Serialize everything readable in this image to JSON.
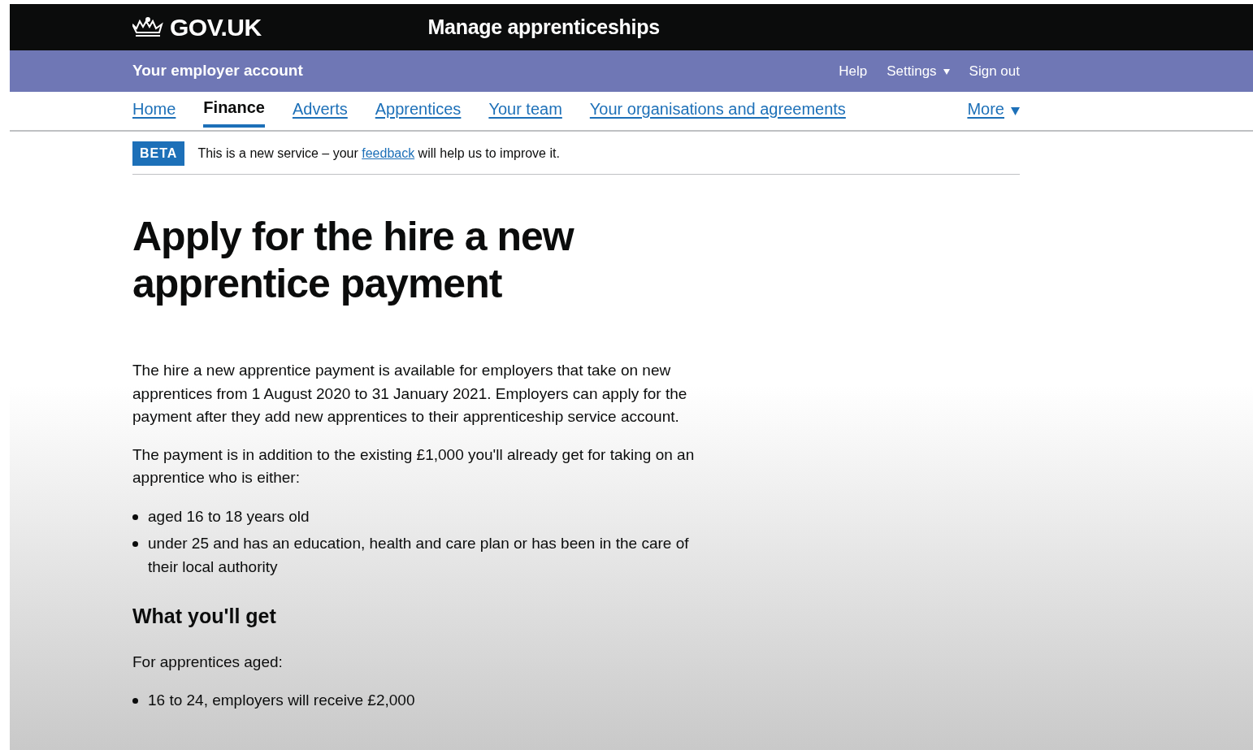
{
  "header": {
    "logo": "GOV.UK",
    "service": "Manage apprenticeships"
  },
  "account_bar": {
    "title": "Your employer account",
    "links": [
      {
        "label": "Help",
        "kind": "link"
      },
      {
        "label": "Settings",
        "kind": "dropdown"
      },
      {
        "label": "Sign out",
        "kind": "link"
      }
    ]
  },
  "nav": {
    "items": [
      {
        "label": "Home",
        "selected": false
      },
      {
        "label": "Finance",
        "selected": true
      },
      {
        "label": "Adverts",
        "selected": false
      },
      {
        "label": "Apprentices",
        "selected": false
      },
      {
        "label": "Your team",
        "selected": false
      },
      {
        "label": "Your organisations and agreements",
        "selected": false
      }
    ],
    "more": "More"
  },
  "beta": {
    "tag": "BETA",
    "before": "This is a new service – your ",
    "link": "feedback",
    "after": " will help us to improve it."
  },
  "content": [
    {
      "kind": "title",
      "text": "Apply for the hire a new apprentice payment"
    },
    {
      "kind": "paragraph",
      "text": "The hire a new apprentice payment is available for employers that take on new apprentices from 1 August 2020 to 31 January 2021. Employers can apply for the payment after they add new apprentices to their apprenticeship service account."
    },
    {
      "kind": "paragraph",
      "text": "The payment is in addition to the existing £1,000 you'll already get for taking on an apprentice who is either:"
    },
    {
      "kind": "list",
      "items": [
        "aged 16 to 18 years old",
        "under 25 and has an education, health and care plan or has been in the care of their local authority"
      ]
    },
    {
      "kind": "heading",
      "text": "What you'll get"
    },
    {
      "kind": "paragraph",
      "text": "For apprentices aged:"
    },
    {
      "kind": "list",
      "items": [
        "16 to 24, employers will receive £2,000"
      ]
    }
  ]
}
